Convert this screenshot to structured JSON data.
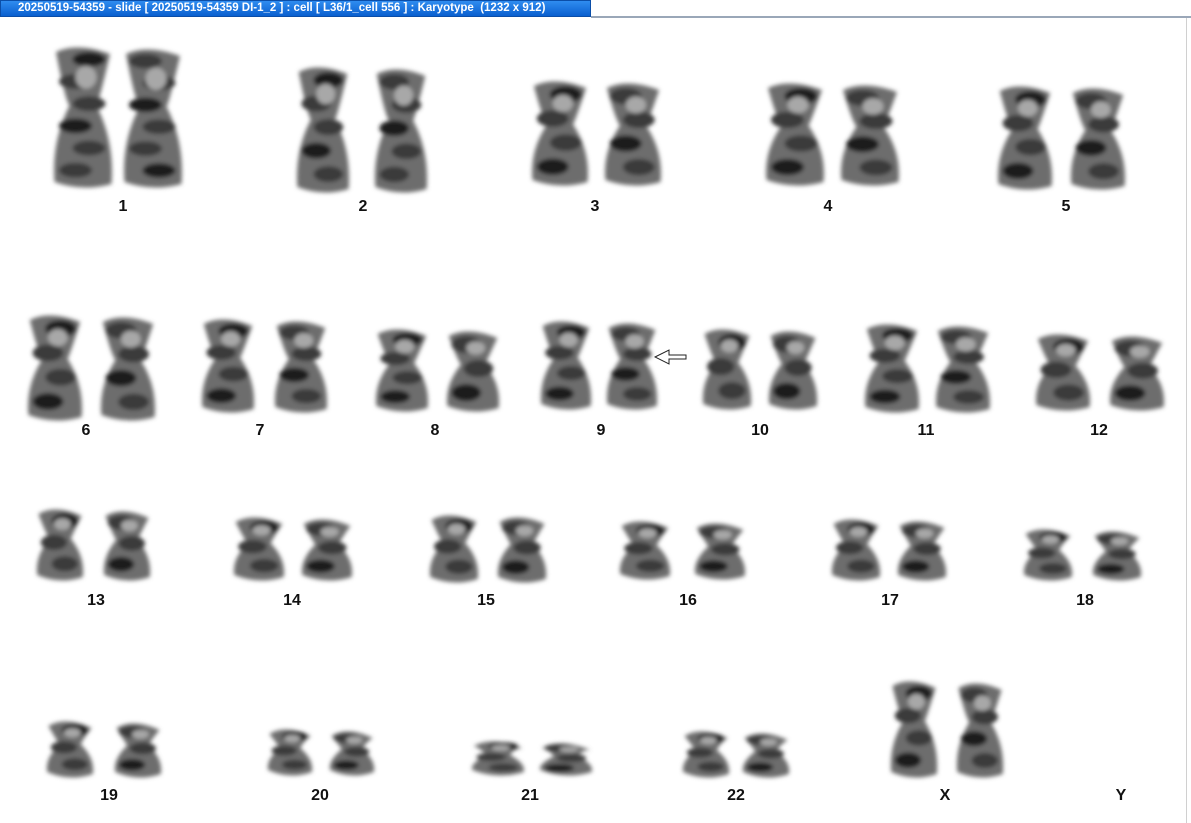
{
  "window": {
    "title": "20250519-54359 - slide [ 20250519-54359 DI-1_2 ] : cell [ L36/1_cell 556 ] : Karyotype  (1232 x 912)"
  },
  "karyotype": {
    "chromosomes": [
      {
        "label": "1"
      },
      {
        "label": "2"
      },
      {
        "label": "3"
      },
      {
        "label": "4"
      },
      {
        "label": "5"
      },
      {
        "label": "6"
      },
      {
        "label": "7"
      },
      {
        "label": "8"
      },
      {
        "label": "9"
      },
      {
        "label": "10"
      },
      {
        "label": "11"
      },
      {
        "label": "12"
      },
      {
        "label": "13"
      },
      {
        "label": "14"
      },
      {
        "label": "15"
      },
      {
        "label": "16"
      },
      {
        "label": "17"
      },
      {
        "label": "18"
      },
      {
        "label": "19"
      },
      {
        "label": "20"
      },
      {
        "label": "21"
      },
      {
        "label": "22"
      },
      {
        "label": "X"
      },
      {
        "label": "Y"
      }
    ],
    "annotation": {
      "marked_chromosome": "9",
      "marker_icon": "arrow-left-icon"
    }
  }
}
